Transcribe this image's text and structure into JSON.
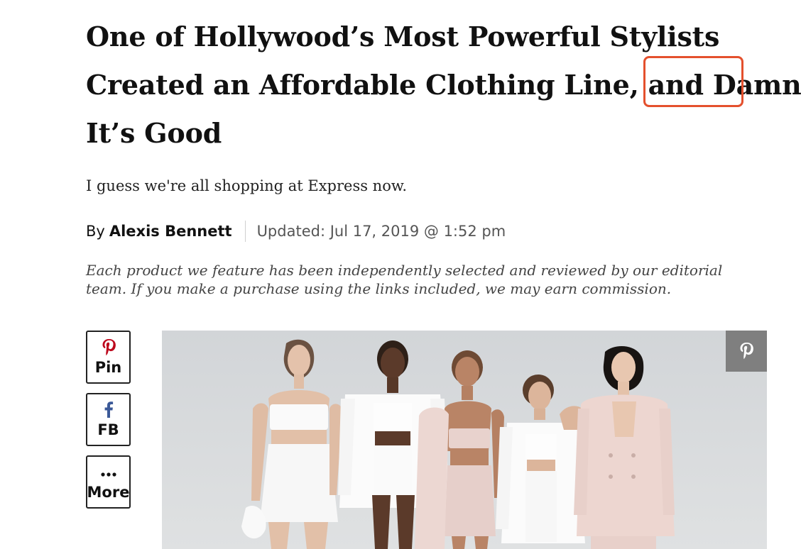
{
  "article": {
    "headline_lines": [
      "One of Hollywood’s Most Powerful Stylists",
      "Created an Affordable Clothing Line, and Damn",
      "It’s Good"
    ],
    "dek": "I guess we're all shopping at Express now.",
    "byline": {
      "prefix": "By",
      "author": "Alexis Bennett",
      "updated": "Updated: Jul 17, 2019 @ 1:52 pm"
    },
    "disclaimer": "Each product we feature has been independently selected and reviewed by our editorial team. If you make a purchase using the links included, we may earn commission."
  },
  "highlight": {
    "word": "Damn",
    "color": "#e4502d"
  },
  "share": {
    "buttons": [
      {
        "label": "Pin",
        "icon": "pinterest-icon"
      },
      {
        "label": "FB",
        "icon": "facebook-icon"
      },
      {
        "label": "More",
        "icon": "more-dots-icon"
      }
    ]
  },
  "hero": {
    "pin_icon": "pinterest-icon"
  },
  "colors": {
    "pinterest": "#bd081c",
    "facebook": "#3b5998",
    "highlight": "#e4502d",
    "hero_pin_bg": "#7f7f7f"
  }
}
